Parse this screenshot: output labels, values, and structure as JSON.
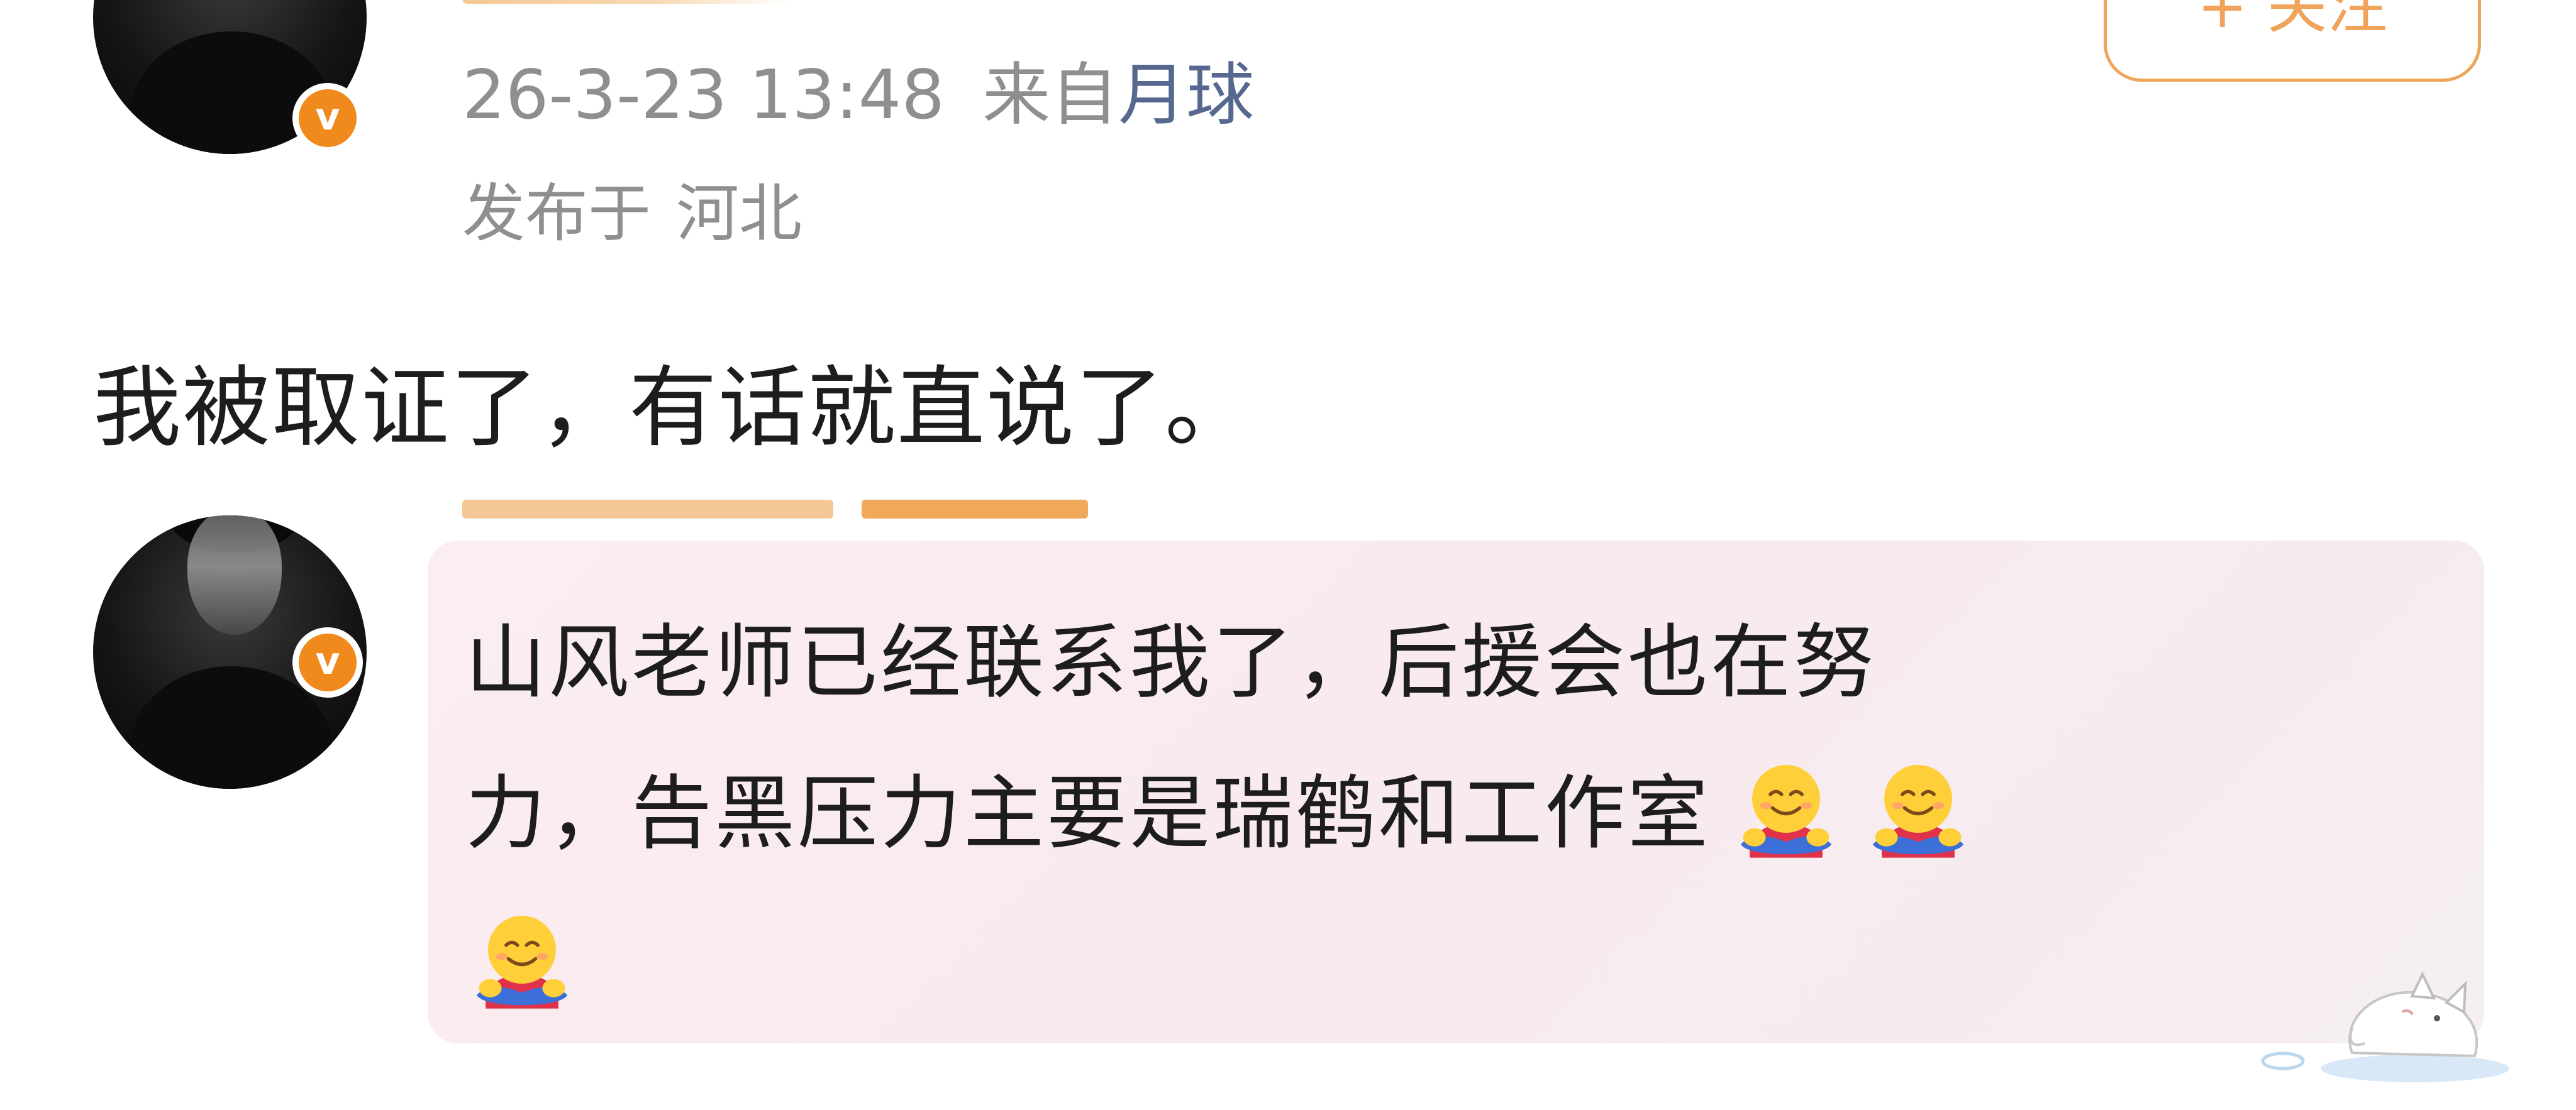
{
  "post": {
    "follow_label": "+ 关注",
    "timestamp": "26-3-23 13:48",
    "source_prefix": "来自",
    "source": "月球",
    "location_prefix": "发布于",
    "location": "河北",
    "text": "我被取证了，有话就直说了。"
  },
  "reply": {
    "line1": "山风老师已经联系我了，后援会也在努",
    "line2": "力，告黑压力主要是瑞鹤和工作室",
    "emoji": "hug-emoji",
    "emoji_count": 3
  },
  "badges": {
    "verified_label": "v"
  },
  "colors": {
    "verified_orange": "#f08a1c",
    "follow_orange": "#f0a35a",
    "meta_gray": "#8f8f8f",
    "source_link": "#56688f",
    "text_dark": "#1d1d1d",
    "bubble_pink": "#f8eaed"
  }
}
